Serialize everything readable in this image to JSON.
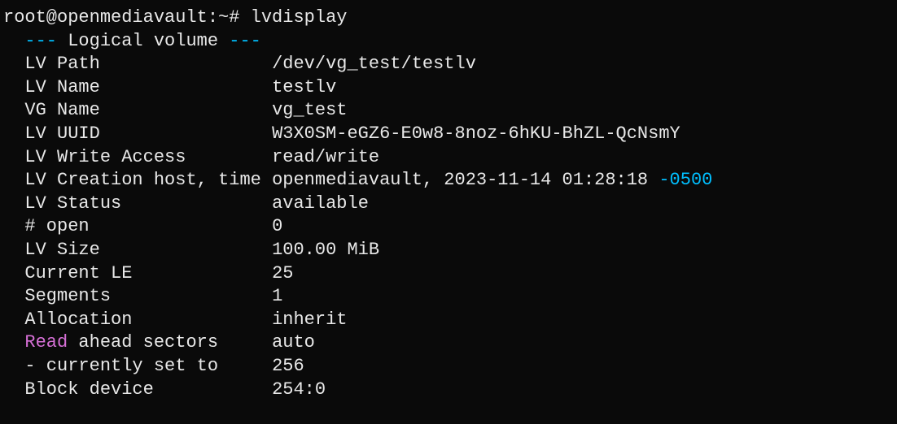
{
  "prompt": {
    "user_host": "root@openmediavault",
    "path": "~",
    "symbol": "#",
    "command": "lvdisplay"
  },
  "header": {
    "dashes_left": "---",
    "title": "Logical volume",
    "dashes_right": "---"
  },
  "fields": {
    "lv_path": {
      "label": "LV Path",
      "value": "/dev/vg_test/testlv"
    },
    "lv_name": {
      "label": "LV Name",
      "value": "testlv"
    },
    "vg_name": {
      "label": "VG Name",
      "value": "vg_test"
    },
    "lv_uuid": {
      "label": "LV UUID",
      "value": "W3X0SM-eGZ6-E0w8-8noz-6hKU-BhZL-QcNsmY"
    },
    "lv_write_access": {
      "label": "LV Write Access",
      "value": "read/write"
    },
    "lv_creation": {
      "label": "LV Creation host, time",
      "value": "openmediavault, 2023-11-14 01:28:18",
      "tz": "-0500"
    },
    "lv_status": {
      "label": "LV Status",
      "value": "available"
    },
    "num_open": {
      "label": "# open",
      "value": "0"
    },
    "lv_size": {
      "label": "LV Size",
      "value": "100.00 MiB"
    },
    "current_le": {
      "label": "Current LE",
      "value": "25"
    },
    "segments": {
      "label": "Segments",
      "value": "1"
    },
    "allocation": {
      "label": "Allocation",
      "value": "inherit"
    },
    "read_ahead": {
      "label_prefix": "Read",
      "label_suffix": " ahead sectors",
      "value": "auto"
    },
    "currently_set": {
      "label": "- currently set to",
      "value": "256"
    },
    "block_device": {
      "label": "Block device",
      "value": "254:0"
    }
  }
}
